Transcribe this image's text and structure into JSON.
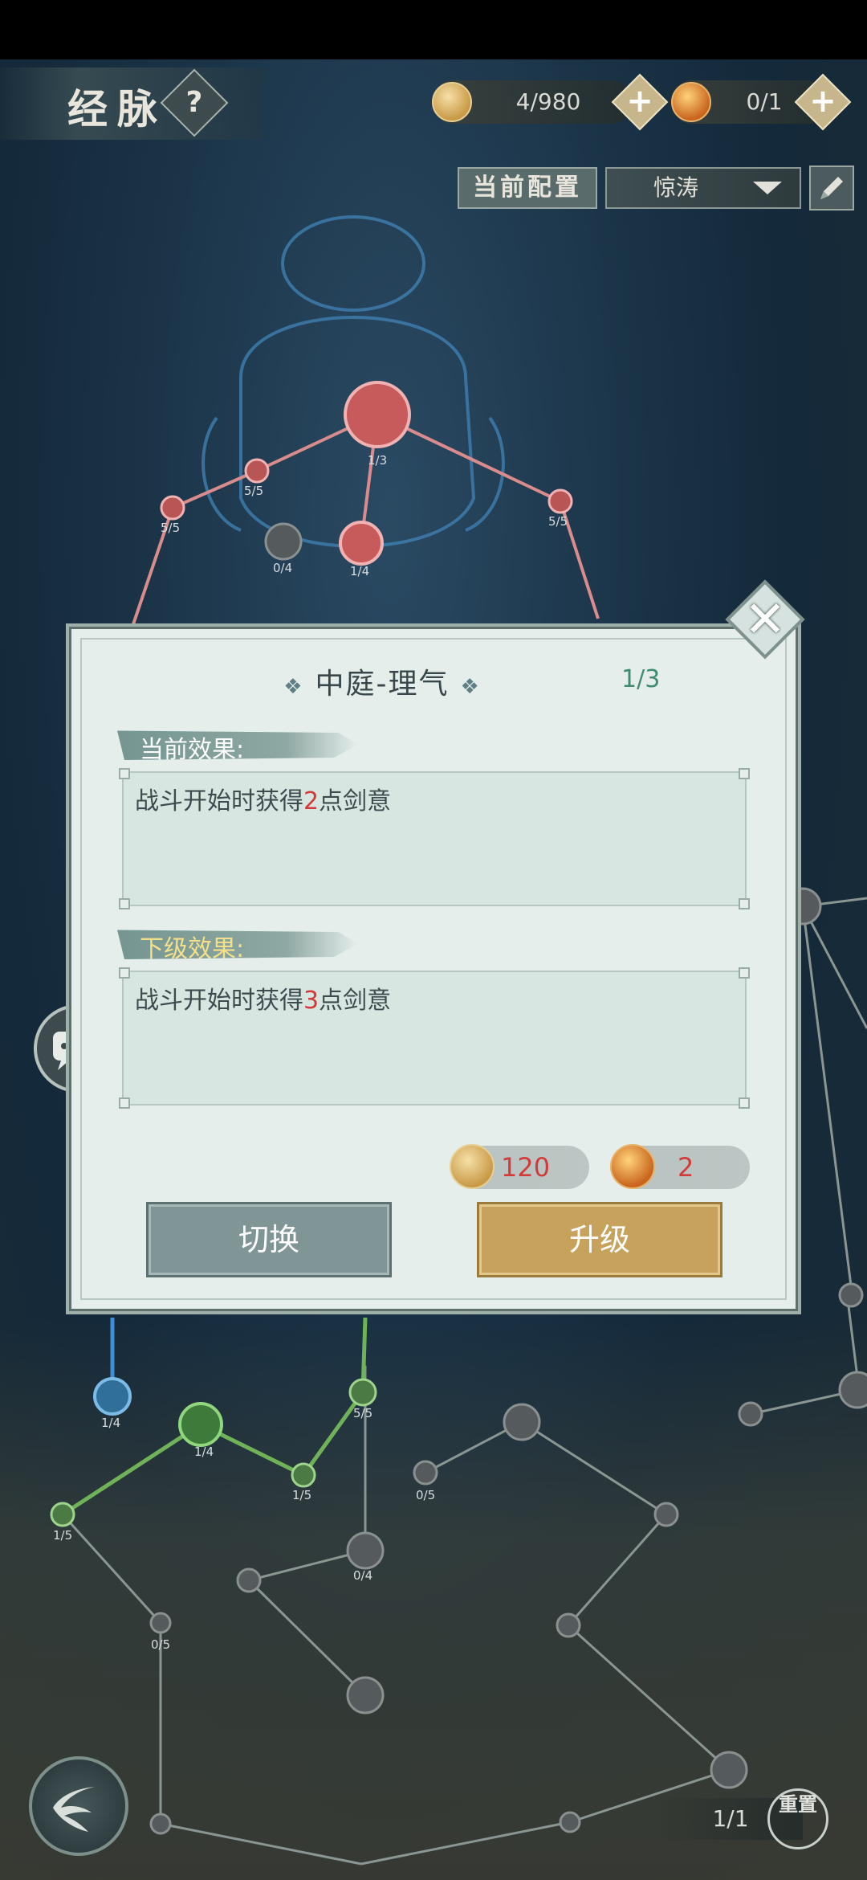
{
  "header": {
    "title": "经脉",
    "help_label": "?",
    "resources": [
      {
        "icon": "yuanqi-coin-icon",
        "text": "4/980"
      },
      {
        "icon": "fire-orb-icon",
        "text": "0/1"
      }
    ],
    "plus_label": "+"
  },
  "config": {
    "label": "当前配置",
    "selected": "惊涛"
  },
  "map_nodes": [
    {
      "label": "1/3"
    },
    {
      "label": "5/5"
    },
    {
      "label": "5/5"
    },
    {
      "label": "0/4"
    },
    {
      "label": "1/4"
    },
    {
      "label": "5/5"
    },
    {
      "label": "1/4"
    },
    {
      "label": "1/4"
    },
    {
      "label": "5/5"
    },
    {
      "label": "1/5"
    },
    {
      "label": "0/5"
    },
    {
      "label": "1/5"
    },
    {
      "label": "0/4"
    },
    {
      "label": "0/5"
    }
  ],
  "dialog": {
    "title": "中庭-理气",
    "title_deco": "❖",
    "level": "1/3",
    "current_tag": "当前效果:",
    "current_effect": {
      "pre": "战斗开始时获得",
      "num": "2",
      "post": "点剑意"
    },
    "next_tag": "下级效果:",
    "next_effect": {
      "pre": "战斗开始时获得",
      "num": "3",
      "post": "点剑意"
    },
    "costs": [
      {
        "icon": "yuanqi-coin-icon",
        "value": "120"
      },
      {
        "icon": "fire-orb-icon",
        "value": "2"
      }
    ],
    "switch_label": "切换",
    "upgrade_label": "升级",
    "close_label": "✕"
  },
  "footer": {
    "page": "1/1",
    "reset_label": "重置"
  },
  "colors": {
    "accent_green": "#3e8c73",
    "upgrade_gold": "#c6a25c",
    "switch_slate": "#7f9596",
    "highlight_red": "#d23a3a"
  }
}
